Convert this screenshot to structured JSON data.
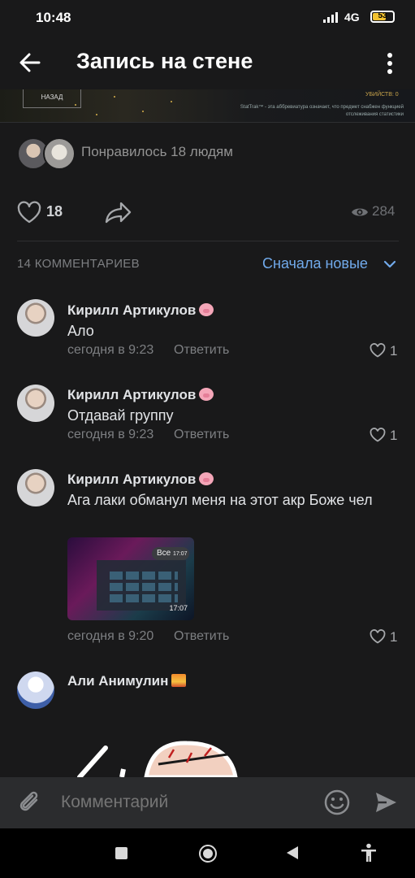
{
  "status_bar": {
    "time": "10:48",
    "network": "4G",
    "battery": "53"
  },
  "header": {
    "title": "Запись на стене",
    "back_icon": "arrow-left-icon",
    "more_icon": "more-vertical-icon"
  },
  "post_image": {
    "button_text": "НАЗАД",
    "kills_text": "УБИЙСТВ: 0",
    "note_text": "StatTrak™ - эта аббревиатура означает, что предмет снабжен функцией отслеживания статистики"
  },
  "likes_row": {
    "liked_by": "Понравилось 18 людям"
  },
  "actions": {
    "likes": "18",
    "views": "284",
    "like_icon": "heart-outline-icon",
    "share_icon": "share-arrow-icon",
    "views_icon": "eye-icon"
  },
  "comments_header": {
    "count": "14 КОММЕНТАРИЕВ",
    "sort": "Сначала новые"
  },
  "comments": [
    {
      "author": "Кирилл Артикулов",
      "text": "Ало",
      "time": "сегодня в 9:23",
      "reply": "Ответить",
      "likes": "1"
    },
    {
      "author": "Кирилл Артикулов",
      "text": "Отдавай группу",
      "time": "сегодня в 9:23",
      "reply": "Ответить",
      "likes": "1"
    },
    {
      "author": "Кирилл Артикулов",
      "text": "Ага лаки обманул меня на этот акр Боже чел",
      "time": "сегодня в 9:20",
      "reply": "Ответить",
      "likes": "1",
      "attachment": {
        "tag": "Все",
        "tag_time": "17:07",
        "timestamp": "17:07"
      }
    },
    {
      "author": "Али Анимулин"
    }
  ],
  "input": {
    "placeholder": "Комментарий"
  },
  "colors": {
    "background": "#19191a",
    "accent": "#71aaeb",
    "secondary_text": "#7d7f82"
  }
}
